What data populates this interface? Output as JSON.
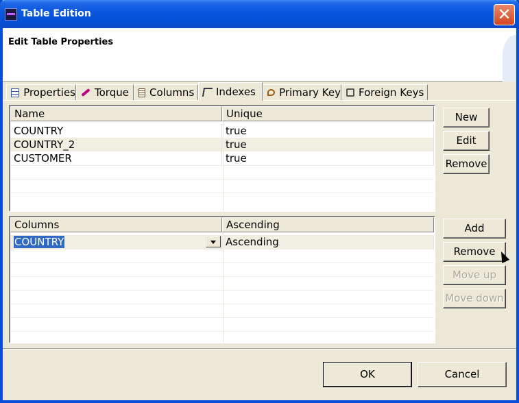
{
  "window": {
    "title": "Table Edition",
    "close_label": "✕"
  },
  "header": {
    "title": "Edit Table Properties"
  },
  "tabs": [
    {
      "label": "Properties",
      "icon": "table-icon"
    },
    {
      "label": "Torque",
      "icon": "torque-icon"
    },
    {
      "label": "Columns",
      "icon": "columns-icon"
    },
    {
      "label": "Indexes",
      "icon": "indexes-icon",
      "active": true
    },
    {
      "label": "Primary Key",
      "icon": "primary-key-icon"
    },
    {
      "label": "Foreign Keys",
      "icon": "foreign-keys-icon"
    }
  ],
  "indexes_table": {
    "headers": [
      "Name",
      "Unique"
    ],
    "rows": [
      [
        "COUNTRY",
        "true"
      ],
      [
        "COUNTRY_2",
        "true"
      ],
      [
        "CUSTOMER",
        "true"
      ]
    ],
    "selected_row": 1
  },
  "index_buttons": {
    "new": "New",
    "edit": "Edit",
    "remove": "Remove"
  },
  "columns_table": {
    "headers": [
      "Columns",
      "Ascending"
    ],
    "rows": [
      [
        "COUNTRY",
        "Ascending"
      ]
    ]
  },
  "column_buttons": {
    "add": "Add",
    "remove": "Remove",
    "move_up": "Move up",
    "move_down": "Move down"
  },
  "footer": {
    "ok": "OK",
    "cancel": "Cancel"
  },
  "colors": {
    "titlebar": "#0a56dc",
    "selection": "#316ac5",
    "face": "#ece9d8"
  }
}
